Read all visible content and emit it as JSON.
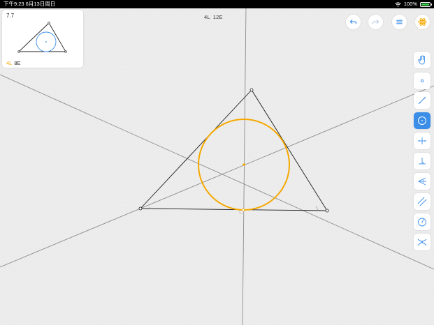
{
  "status_bar": {
    "time": "下午9:23  6月13日周日",
    "battery": "100%"
  },
  "level": {
    "number": "7.7",
    "goal_l": "4L",
    "goal_e": "8E"
  },
  "move_counter": {
    "l": "4L",
    "e": "12E"
  },
  "colors": {
    "accent_orange": "#f5a800",
    "accent_blue": "#3a8ee8",
    "line_gray": "#8c8c8c",
    "background": "#ececed"
  },
  "top_buttons": [
    {
      "name": "undo-button",
      "icon": "undo-arrow-icon"
    },
    {
      "name": "redo-button",
      "icon": "redo-arrow-icon"
    },
    {
      "name": "menu-button",
      "icon": "hamburger-menu-icon"
    },
    {
      "name": "hint-button",
      "icon": "atom-hint-icon"
    }
  ],
  "tools": [
    {
      "name": "tool-move",
      "icon": "hand-icon",
      "active": false
    },
    {
      "name": "tool-point",
      "icon": "point-icon",
      "active": false
    },
    {
      "name": "tool-line",
      "icon": "line-icon",
      "active": false
    },
    {
      "name": "tool-circle",
      "icon": "circle-icon",
      "active": true
    },
    {
      "name": "tool-perpendicular-bisector",
      "icon": "perpendicular-bisector-icon",
      "active": false
    },
    {
      "name": "tool-perpendicular",
      "icon": "perpendicular-icon",
      "active": false
    },
    {
      "name": "tool-angle-bisector",
      "icon": "angle-bisector-icon",
      "active": false
    },
    {
      "name": "tool-parallel",
      "icon": "parallel-icon",
      "active": false
    },
    {
      "name": "tool-compass",
      "icon": "compass-icon",
      "active": false
    },
    {
      "name": "tool-intersect",
      "icon": "intersection-icon",
      "active": false
    }
  ]
}
